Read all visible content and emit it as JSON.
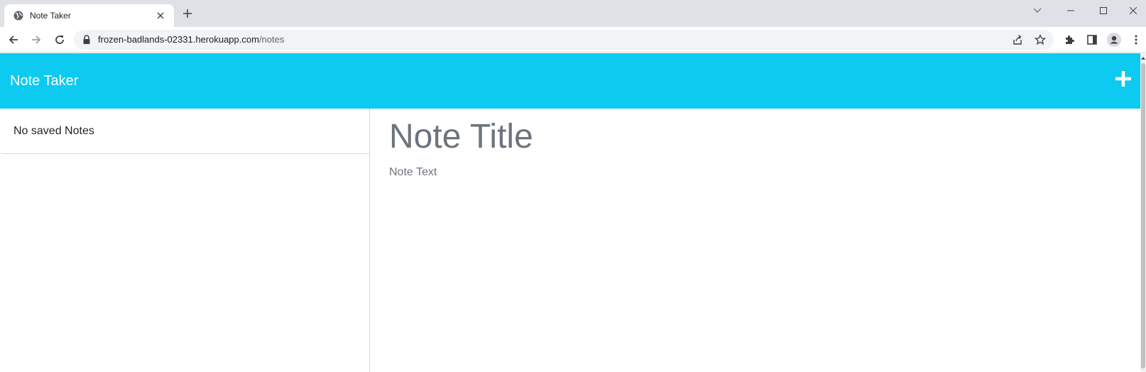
{
  "browser": {
    "tab_title": "Note Taker",
    "url_host": "frozen-badlands-02331.herokuapp.com",
    "url_path": "/notes"
  },
  "app": {
    "brand": "Note Taker",
    "empty_notes_label": "No saved Notes",
    "title_placeholder": "Note Title",
    "text_placeholder": "Note Text",
    "accent_color": "#0dcaf0"
  }
}
